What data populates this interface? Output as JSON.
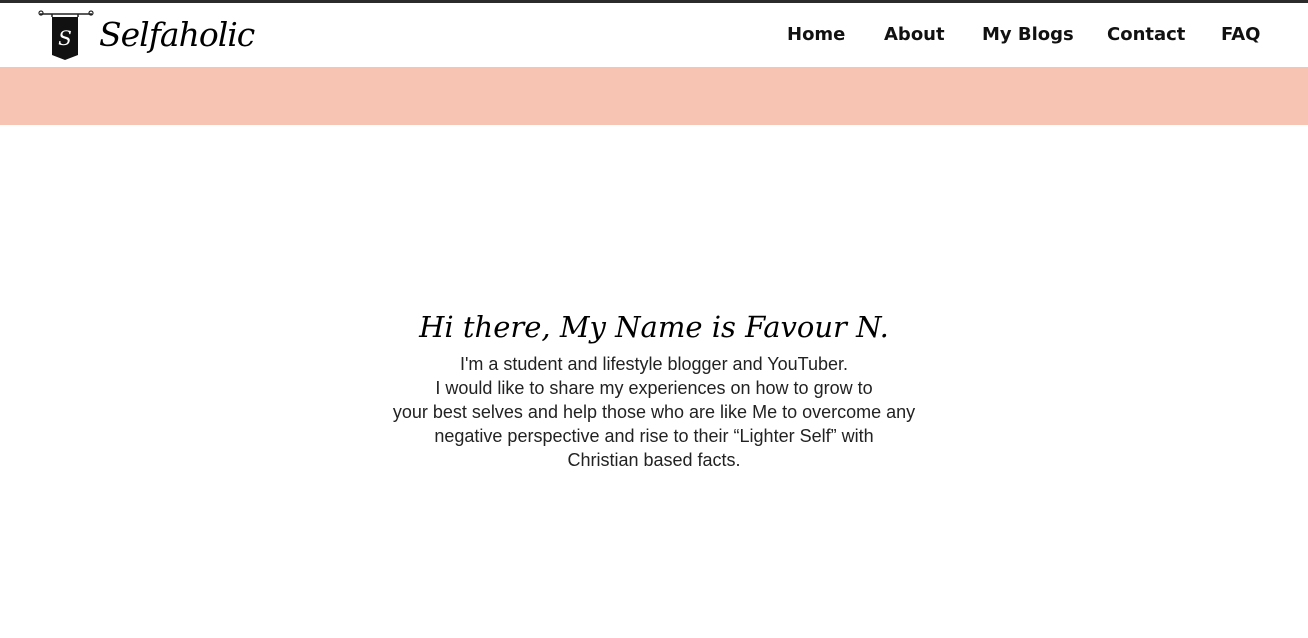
{
  "theme": {
    "banner_color": "#f7c4b3",
    "text_color": "#111111",
    "top_rule_color": "#2b2b2b"
  },
  "brand": {
    "name": "Selfaholic",
    "badge_letter": "S",
    "icon": "hanging-banner-logo-icon"
  },
  "nav": {
    "items": [
      {
        "label": "Home"
      },
      {
        "label": "About"
      },
      {
        "label": "My Blogs"
      },
      {
        "label": "Contact"
      },
      {
        "label": "FAQ"
      }
    ]
  },
  "intro": {
    "heading": "Hi there, My Name is Favour N.",
    "lines": [
      "I'm a student and lifestyle blogger and YouTuber.",
      "I would like to share my experiences on how to grow to",
      "your best selves and help those who are like Me to overcome any",
      "negative perspective and rise to their “Lighter Self” with",
      "Christian based facts."
    ]
  }
}
